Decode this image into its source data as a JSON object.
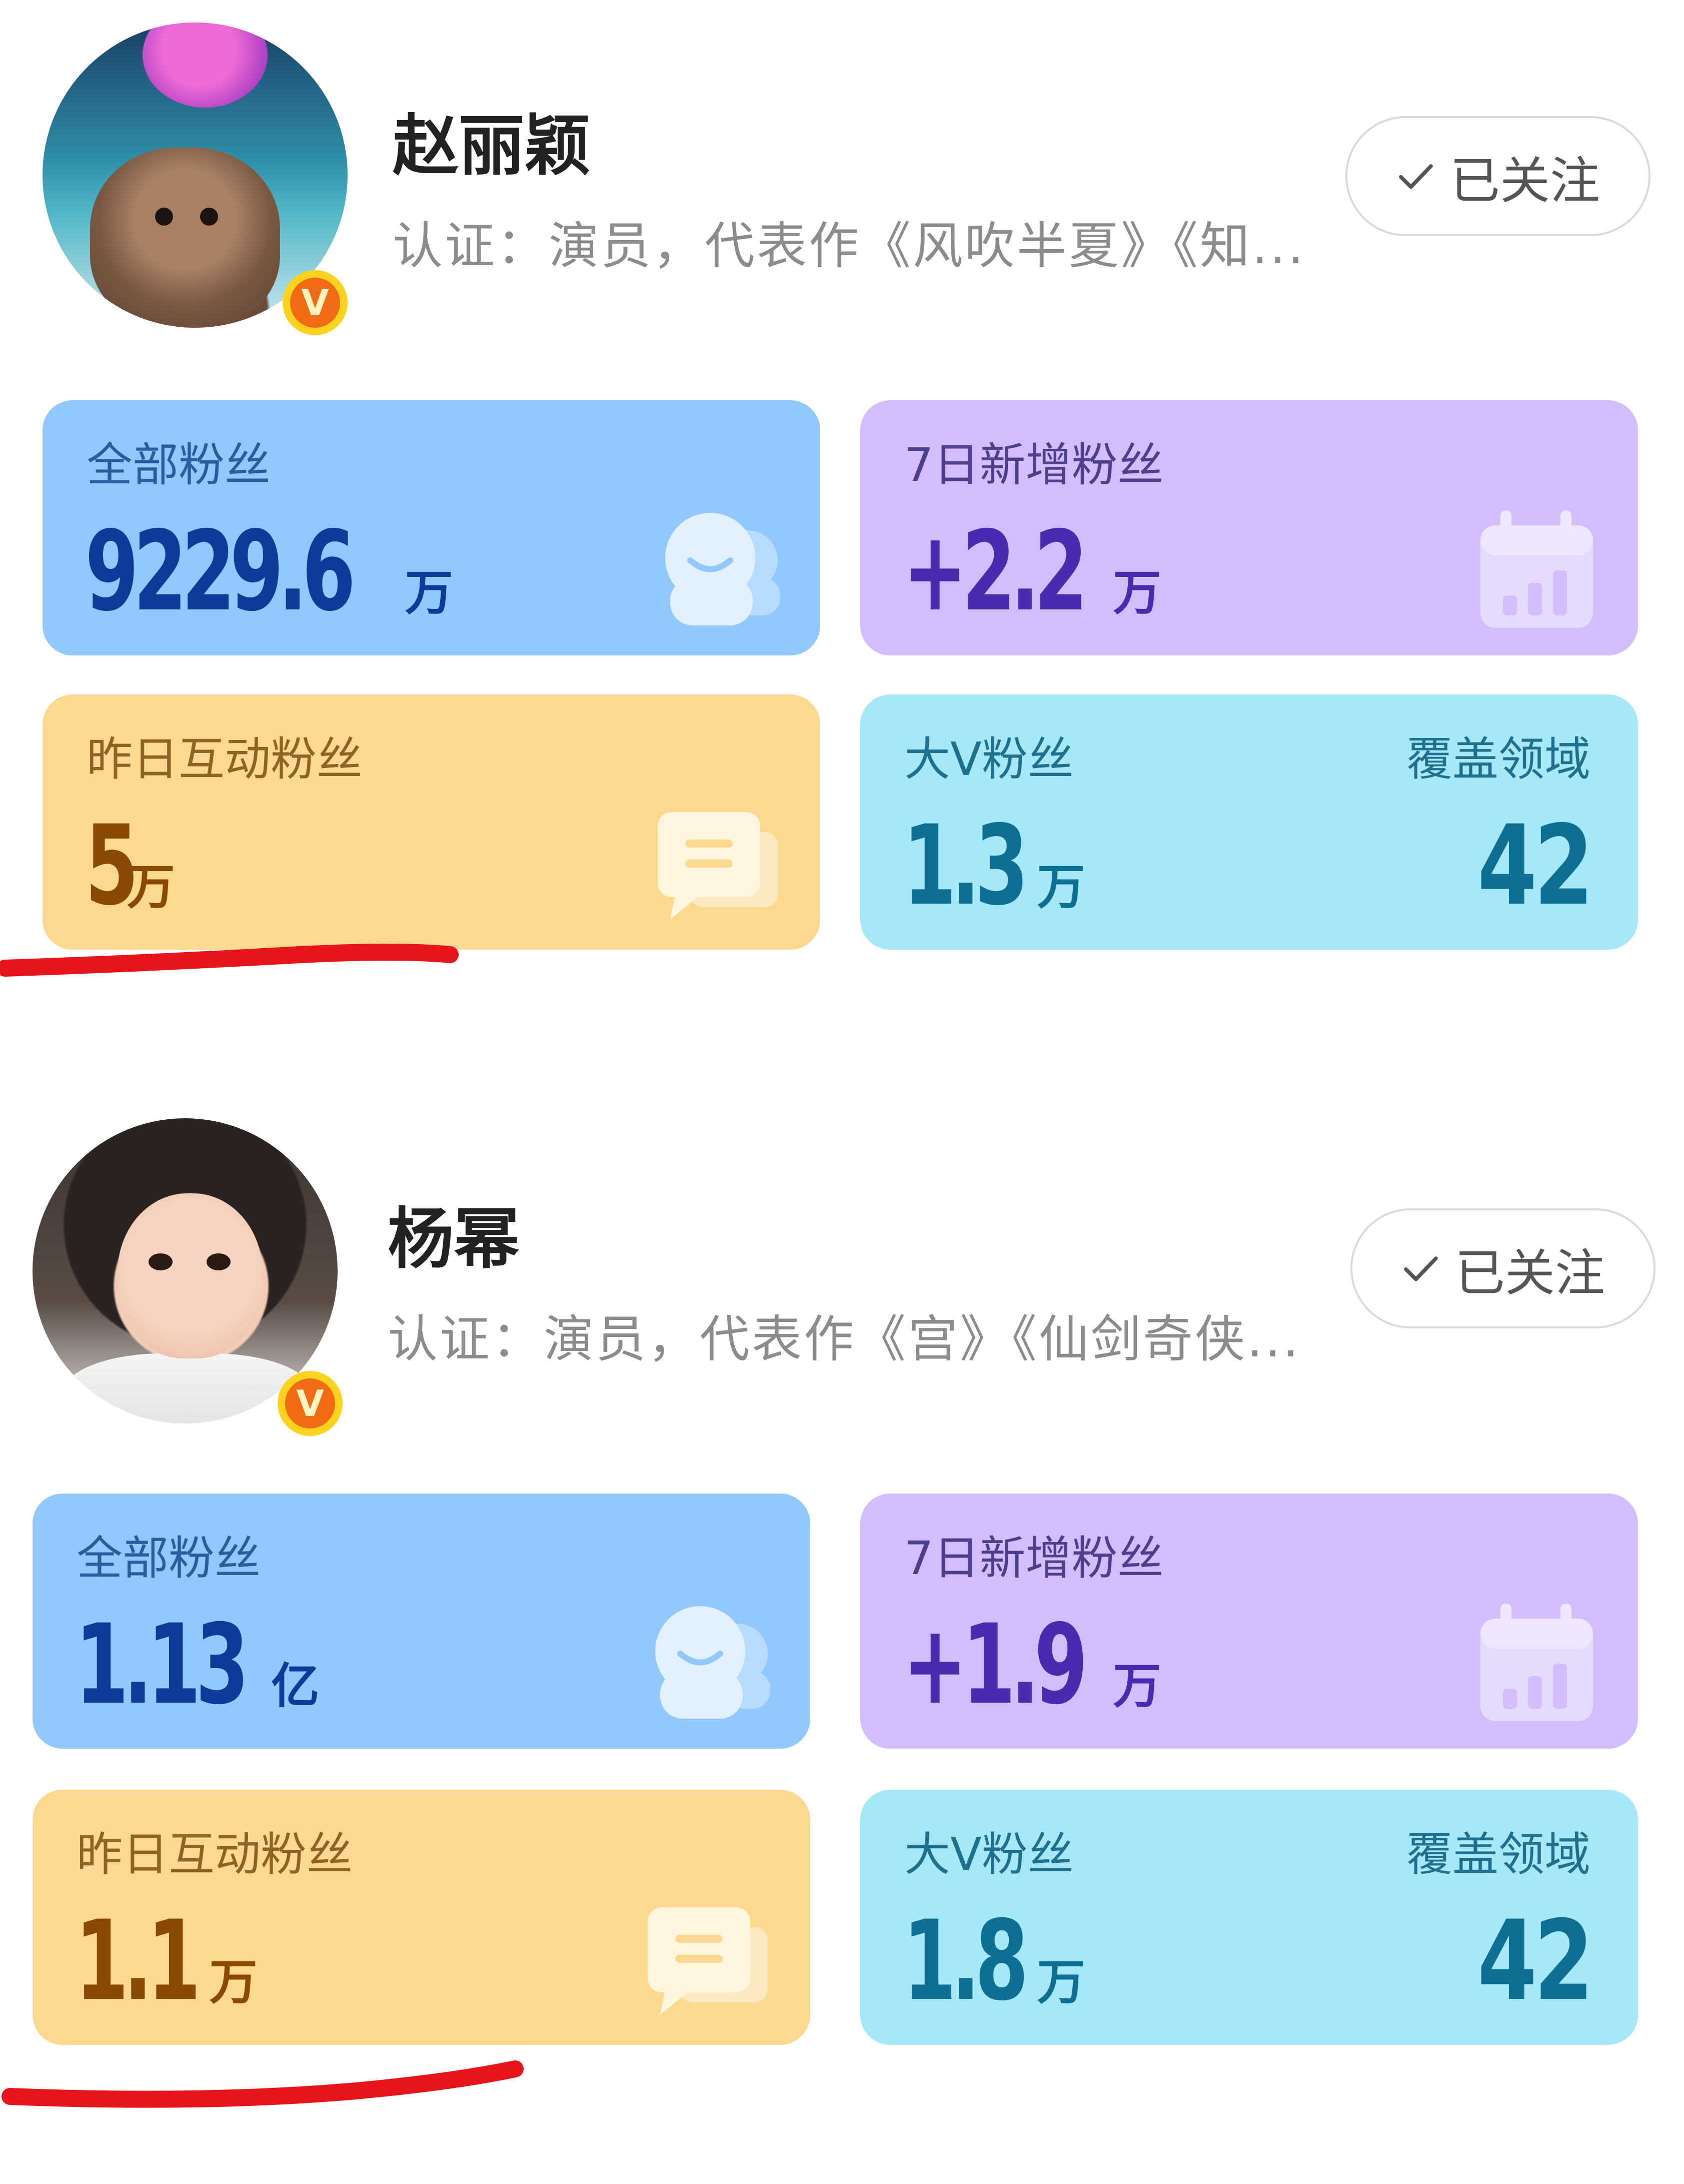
{
  "profiles": [
    {
      "name": "赵丽颖",
      "certification": "认证：演员，代表作《风吹半夏》《知...",
      "follow_label": "已关注",
      "stats": {
        "total_fans": {
          "label": "全部粉丝",
          "value": "9229.6",
          "unit": "万"
        },
        "new_7d": {
          "label": "7日新增粉丝",
          "value": "+2.2",
          "unit": "万"
        },
        "interactive_yesterday": {
          "label": "昨日互动粉丝",
          "value": "5",
          "unit": "万"
        },
        "bigv_fans": {
          "label": "大V粉丝",
          "value": "1.3",
          "unit": "万",
          "coverage_label": "覆盖领域",
          "coverage_value": "42"
        }
      }
    },
    {
      "name": "杨幂",
      "certification": "认证：演员，代表作《宫》《仙剑奇侠...",
      "follow_label": "已关注",
      "stats": {
        "total_fans": {
          "label": "全部粉丝",
          "value": "1.13",
          "unit": "亿"
        },
        "new_7d": {
          "label": "7日新增粉丝",
          "value": "+1.9",
          "unit": "万"
        },
        "interactive_yesterday": {
          "label": "昨日互动粉丝",
          "value": "1.1",
          "unit": "万"
        },
        "bigv_fans": {
          "label": "大V粉丝",
          "value": "1.8",
          "unit": "万",
          "coverage_label": "覆盖领域",
          "coverage_value": "42"
        }
      }
    }
  ],
  "icons": {
    "verified_badge": "v-badge-icon",
    "check": "checkmark-icon",
    "fans": "fans-group-icon",
    "calendar": "calendar-chart-icon",
    "chat": "chat-bubble-icon"
  },
  "colors": {
    "total_fans_card": "#91c8ff",
    "new_7d_card": "#d3bdfc",
    "interactive_card": "#fcd98e",
    "bigv_card": "#a7e8f8",
    "annotation_underline": "#e8141c",
    "verified_badge": "#f26a13"
  }
}
